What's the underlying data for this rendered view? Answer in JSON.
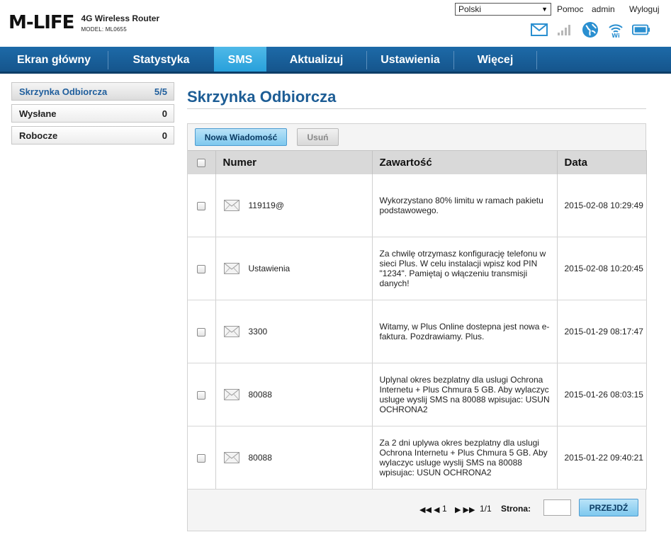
{
  "brand": {
    "logo": "M-LIFE",
    "title": "4G Wireless Router",
    "model": "MODEL: ML0655"
  },
  "topbar": {
    "language": "Polski",
    "help": "Pomoc",
    "user": "admin",
    "logout": "Wyloguj"
  },
  "status_icons": [
    "envelope-icon",
    "signal-icon",
    "globe-icon",
    "wifi-icon",
    "battery-icon"
  ],
  "nav": {
    "items": [
      {
        "label": "Ekran główny"
      },
      {
        "label": "Statystyka"
      },
      {
        "label": "SMS",
        "active": true
      },
      {
        "label": "Aktualizuj"
      },
      {
        "label": "Ustawienia"
      },
      {
        "label": "Więcej"
      }
    ]
  },
  "sidebar": {
    "items": [
      {
        "label": "Skrzynka Odbiorcza",
        "count": "5/5",
        "active": true
      },
      {
        "label": "Wysłane",
        "count": "0"
      },
      {
        "label": "Robocze",
        "count": "0"
      }
    ]
  },
  "main": {
    "title": "Skrzynka Odbiorcza",
    "new_button": "Nowa Wiadomość",
    "delete_button": "Usuń",
    "columns": {
      "number": "Numer",
      "content": "Zawartość",
      "date": "Data"
    },
    "messages": [
      {
        "number": "119119@",
        "content": "Wykorzystano 80% limitu w ramach pakietu podstawowego.",
        "date": "2015-02-08 10:29:49"
      },
      {
        "number": "Ustawienia",
        "content": "Za chwilę otrzymasz konfigurację telefonu w sieci Plus. W celu instalacji wpisz kod PIN \"1234\". Pamiętaj o włączeniu transmisji danych!",
        "date": "2015-02-08 10:20:45"
      },
      {
        "number": "3300",
        "content": "Witamy, w Plus Online dostepna jest nowa e-faktura. Pozdrawiamy. Plus.",
        "date": "2015-01-29 08:17:47"
      },
      {
        "number": "80088",
        "content": "Uplynal okres bezplatny dla uslugi Ochrona Internetu + Plus Chmura 5 GB. Aby wylaczyc usluge wyslij SMS na 80088 wpisujac: USUN OCHRONA2",
        "date": "2015-01-26 08:03:15"
      },
      {
        "number": "80088",
        "content": "Za 2 dni uplywa okres bezplatny dla uslugi Ochrona Internetu + Plus Chmura 5 GB. Aby wylaczyc usluge wyslij SMS na 80088 wpisujac: USUN OCHRONA2",
        "date": "2015-01-22 09:40:21"
      }
    ],
    "pager": {
      "current": "1",
      "total": "1/1",
      "page_label": "Strona:",
      "page_input": "",
      "go_button": "PRZEJDŹ"
    }
  },
  "colors": {
    "nav_bg": "#1a629e",
    "nav_active": "#37aae0",
    "title": "#1d5d95",
    "button_primary": "#8fd0f2"
  }
}
